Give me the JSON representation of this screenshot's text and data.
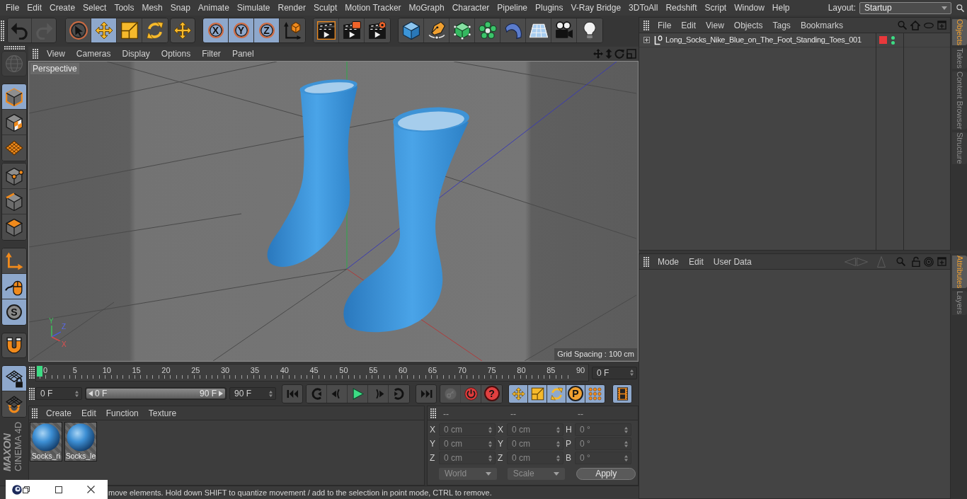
{
  "menu_bar": {
    "items": [
      "File",
      "Edit",
      "Create",
      "Select",
      "Tools",
      "Mesh",
      "Snap",
      "Animate",
      "Simulate",
      "Render",
      "Sculpt",
      "Motion Tracker",
      "MoGraph",
      "Character",
      "Pipeline",
      "Plugins",
      "V-Ray Bridge",
      "3DToAll",
      "Redshift",
      "Script",
      "Window",
      "Help"
    ],
    "layout_label": "Layout:",
    "layout_value": "Startup"
  },
  "toolbar": {
    "groups": [
      {
        "buttons": [
          {
            "kind": "undo",
            "selected": false,
            "disabled": false
          },
          {
            "kind": "redo",
            "selected": false,
            "disabled": true
          }
        ]
      },
      {
        "buttons": [
          {
            "kind": "select",
            "selected": false,
            "disabled": false
          },
          {
            "kind": "move",
            "selected": true,
            "disabled": false
          },
          {
            "kind": "scale",
            "selected": false,
            "disabled": false
          },
          {
            "kind": "rotate",
            "selected": false,
            "disabled": false
          }
        ]
      },
      {
        "buttons": [
          {
            "kind": "move",
            "selected": false,
            "disabled": false
          }
        ]
      },
      {
        "buttons": [
          {
            "kind": "axis",
            "label": "X",
            "selected": true,
            "disabled": false
          },
          {
            "kind": "axis",
            "label": "Y",
            "selected": true,
            "disabled": false
          },
          {
            "kind": "axis",
            "label": "Z",
            "selected": true,
            "disabled": false
          },
          {
            "kind": "coordinates",
            "selected": false,
            "disabled": false
          }
        ]
      },
      {
        "buttons": [
          {
            "kind": "renderview",
            "selected": false,
            "disabled": false
          },
          {
            "kind": "renderpicture",
            "selected": false,
            "disabled": false
          },
          {
            "kind": "rendersettings",
            "selected": false,
            "disabled": false
          }
        ]
      },
      {
        "buttons": [
          {
            "kind": "cube",
            "selected": false,
            "disabled": false
          },
          {
            "kind": "pen",
            "selected": false,
            "disabled": false
          },
          {
            "kind": "subdivision",
            "selected": false,
            "disabled": false
          },
          {
            "kind": "cloner",
            "selected": false,
            "disabled": false
          },
          {
            "kind": "deformer",
            "selected": false,
            "disabled": false
          },
          {
            "kind": "floor",
            "selected": false,
            "disabled": false
          },
          {
            "kind": "camera",
            "selected": false,
            "disabled": false
          },
          {
            "kind": "light",
            "selected": false,
            "disabled": false
          }
        ]
      }
    ]
  },
  "left_toolbar": {
    "groups": [
      {
        "buttons": [
          {
            "kind": "editable",
            "selected": false,
            "disabled": true
          }
        ]
      },
      {
        "buttons": [
          {
            "kind": "model",
            "selected": true,
            "disabled": false
          },
          {
            "kind": "texture",
            "selected": false,
            "disabled": false
          },
          {
            "kind": "workplane",
            "selected": false,
            "disabled": false
          }
        ]
      },
      {
        "buttons": [
          {
            "kind": "points",
            "selected": false,
            "disabled": false
          },
          {
            "kind": "edges",
            "selected": false,
            "disabled": false
          },
          {
            "kind": "polygons",
            "selected": false,
            "disabled": false
          }
        ]
      },
      {
        "buttons": [
          {
            "kind": "axismode",
            "selected": false,
            "disabled": false
          },
          {
            "kind": "tweak",
            "selected": true,
            "disabled": false
          },
          {
            "kind": "solo",
            "label": "S",
            "selected": true,
            "disabled": false
          }
        ]
      },
      {
        "buttons": [
          {
            "kind": "snap",
            "selected": false,
            "disabled": false
          }
        ]
      },
      {
        "buttons": [
          {
            "kind": "lockedplane",
            "selected": true,
            "disabled": false
          },
          {
            "kind": "planarplane",
            "selected": false,
            "disabled": false
          }
        ]
      }
    ]
  },
  "logo": {
    "brand": "MAXON",
    "product": "CINEMA 4D"
  },
  "viewport": {
    "menu": [
      "View",
      "Cameras",
      "Display",
      "Options",
      "Filter",
      "Panel"
    ],
    "camera": "Perspective",
    "grid_spacing": "Grid Spacing : 100 cm",
    "gizmo_labels": [
      "Y",
      "Z",
      "X"
    ]
  },
  "timeline": {
    "ticks": [
      "0",
      "5",
      "10",
      "15",
      "20",
      "25",
      "30",
      "35",
      "40",
      "45",
      "50",
      "55",
      "60",
      "65",
      "70",
      "75",
      "80",
      "85",
      "90"
    ],
    "level": 0,
    "frame_field": "0 F"
  },
  "playback": {
    "start_field": "0 F",
    "range": {
      "start": "0 F",
      "end": "90 F",
      "level": 1
    },
    "end_field": "90 F",
    "groups": [
      {
        "buttons": [
          {
            "kind": "first",
            "selected": false,
            "disabled": false
          }
        ]
      },
      {
        "buttons": [
          {
            "kind": "prevkey",
            "selected": false,
            "disabled": false
          },
          {
            "kind": "prevframe",
            "selected": false,
            "disabled": false
          },
          {
            "kind": "play",
            "selected": false,
            "disabled": false
          },
          {
            "kind": "nextframe",
            "selected": false,
            "disabled": false
          },
          {
            "kind": "nextkey",
            "selected": false,
            "disabled": false
          }
        ]
      },
      {
        "buttons": [
          {
            "kind": "last",
            "selected": false,
            "disabled": false
          }
        ]
      },
      {
        "buttons": [
          {
            "kind": "record",
            "selected": false,
            "disabled": true
          },
          {
            "kind": "autokey",
            "selected": false,
            "disabled": false
          },
          {
            "kind": "keyselection",
            "label": "?",
            "selected": false,
            "disabled": false
          }
        ]
      },
      {
        "buttons": [
          {
            "kind": "position",
            "selected": true,
            "disabled": false
          },
          {
            "kind": "scaling",
            "selected": true,
            "disabled": false
          },
          {
            "kind": "rotation",
            "selected": true,
            "disabled": false
          },
          {
            "kind": "parameter",
            "label": "P",
            "selected": true,
            "disabled": false
          },
          {
            "kind": "pointlevel",
            "selected": true,
            "disabled": false
          }
        ]
      },
      {
        "buttons": [
          {
            "kind": "timeline",
            "selected": true,
            "disabled": false
          }
        ]
      }
    ]
  },
  "materials": {
    "menu": [
      "Create",
      "Edit",
      "Function",
      "Texture"
    ],
    "items": [
      {
        "name": "Socks_ri"
      },
      {
        "name": "Socks_le"
      }
    ]
  },
  "coordinates": {
    "columns": [
      {
        "header": "--",
        "fields": [
          {
            "label": "X",
            "value": "0 cm"
          },
          {
            "label": "Y",
            "value": "0 cm"
          },
          {
            "label": "Z",
            "value": "0 cm"
          }
        ]
      },
      {
        "header": "--",
        "fields": [
          {
            "label": "X",
            "value": "0 cm"
          },
          {
            "label": "Y",
            "value": "0 cm"
          },
          {
            "label": "Z",
            "value": "0 cm"
          }
        ]
      },
      {
        "header": "--",
        "fields": [
          {
            "label": "H",
            "value": "0 °"
          },
          {
            "label": "P",
            "value": "0 °"
          },
          {
            "label": "B",
            "value": "0 °"
          }
        ]
      }
    ],
    "system": "World",
    "mode": "Scale",
    "apply": "Apply"
  },
  "objects_panel": {
    "menu": [
      "File",
      "Edit",
      "View",
      "Objects",
      "Tags",
      "Bookmarks"
    ],
    "objects": [
      {
        "name": "Long_Socks_Nike_Blue_on_The_Foot_Standing_Toes_001",
        "expanded": false,
        "selected": false,
        "editor_visible": true,
        "render_visible": true
      }
    ]
  },
  "attributes_panel": {
    "menu": [
      "Mode",
      "Edit",
      "User Data"
    ]
  },
  "side_tabs": {
    "upper": [
      {
        "label": "Objects",
        "selected": true
      },
      {
        "label": "Takes",
        "selected": false
      },
      {
        "label": "Content Browser",
        "selected": false
      },
      {
        "label": "Structure",
        "selected": false
      }
    ],
    "lower": [
      {
        "label": "Attributes",
        "selected": true
      },
      {
        "label": "Layers",
        "selected": false
      }
    ]
  },
  "status_bar": {
    "text": "move elements. Hold down SHIFT to quantize movement / add to the selection in point mode, CTRL to remove."
  }
}
